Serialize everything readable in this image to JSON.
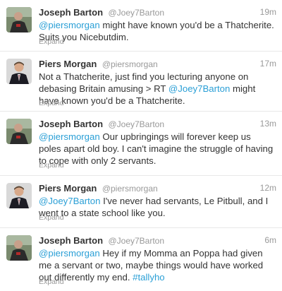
{
  "tweets": [
    {
      "name": "Joseph Barton",
      "handle": "@Joey7Barton",
      "time": "19m",
      "avatar": "joseph-barton-avatar",
      "text": [
        {
          "t": "mention",
          "v": "@piersmorgan"
        },
        {
          "t": "text",
          "v": " might have known you'd be a Thatcherite. Suits you Nicebutdim."
        }
      ],
      "expand": "Expand"
    },
    {
      "name": "Piers Morgan",
      "handle": "@piersmorgan",
      "time": "17m",
      "avatar": "piers-morgan-avatar",
      "text": [
        {
          "t": "text",
          "v": "Not a Thatcherite, just find you lecturing anyone on debasing Britain amusing > RT "
        },
        {
          "t": "mention",
          "v": "@Joey7Barton"
        },
        {
          "t": "text",
          "v": " might have known you'd be a Thatcherite."
        }
      ],
      "expand": "Expand"
    },
    {
      "name": "Joseph Barton",
      "handle": "@Joey7Barton",
      "time": "13m",
      "avatar": "joseph-barton-avatar",
      "text": [
        {
          "t": "mention",
          "v": "@piersmorgan"
        },
        {
          "t": "text",
          "v": " Our upbringings will forever keep us poles apart old boy. I can't imagine the struggle of having to cope with only 2 servants."
        }
      ],
      "expand": "Expand"
    },
    {
      "name": "Piers Morgan",
      "handle": "@piersmorgan",
      "time": "12m",
      "avatar": "piers-morgan-avatar",
      "text": [
        {
          "t": "mention",
          "v": "@Joey7Barton"
        },
        {
          "t": "text",
          "v": " I've never had servants, Le Pitbull, and I went to a state school like you."
        }
      ],
      "expand": "Expand"
    },
    {
      "name": "Joseph Barton",
      "handle": "@Joey7Barton",
      "time": "6m",
      "avatar": "joseph-barton-avatar",
      "text": [
        {
          "t": "mention",
          "v": "@piersmorgan"
        },
        {
          "t": "text",
          "v": " Hey if my Momma an Poppa had given me a servant or two, maybe things would have worked out differently my end. "
        },
        {
          "t": "hashtag",
          "v": "#tallyho"
        }
      ],
      "expand": "Expand"
    }
  ]
}
